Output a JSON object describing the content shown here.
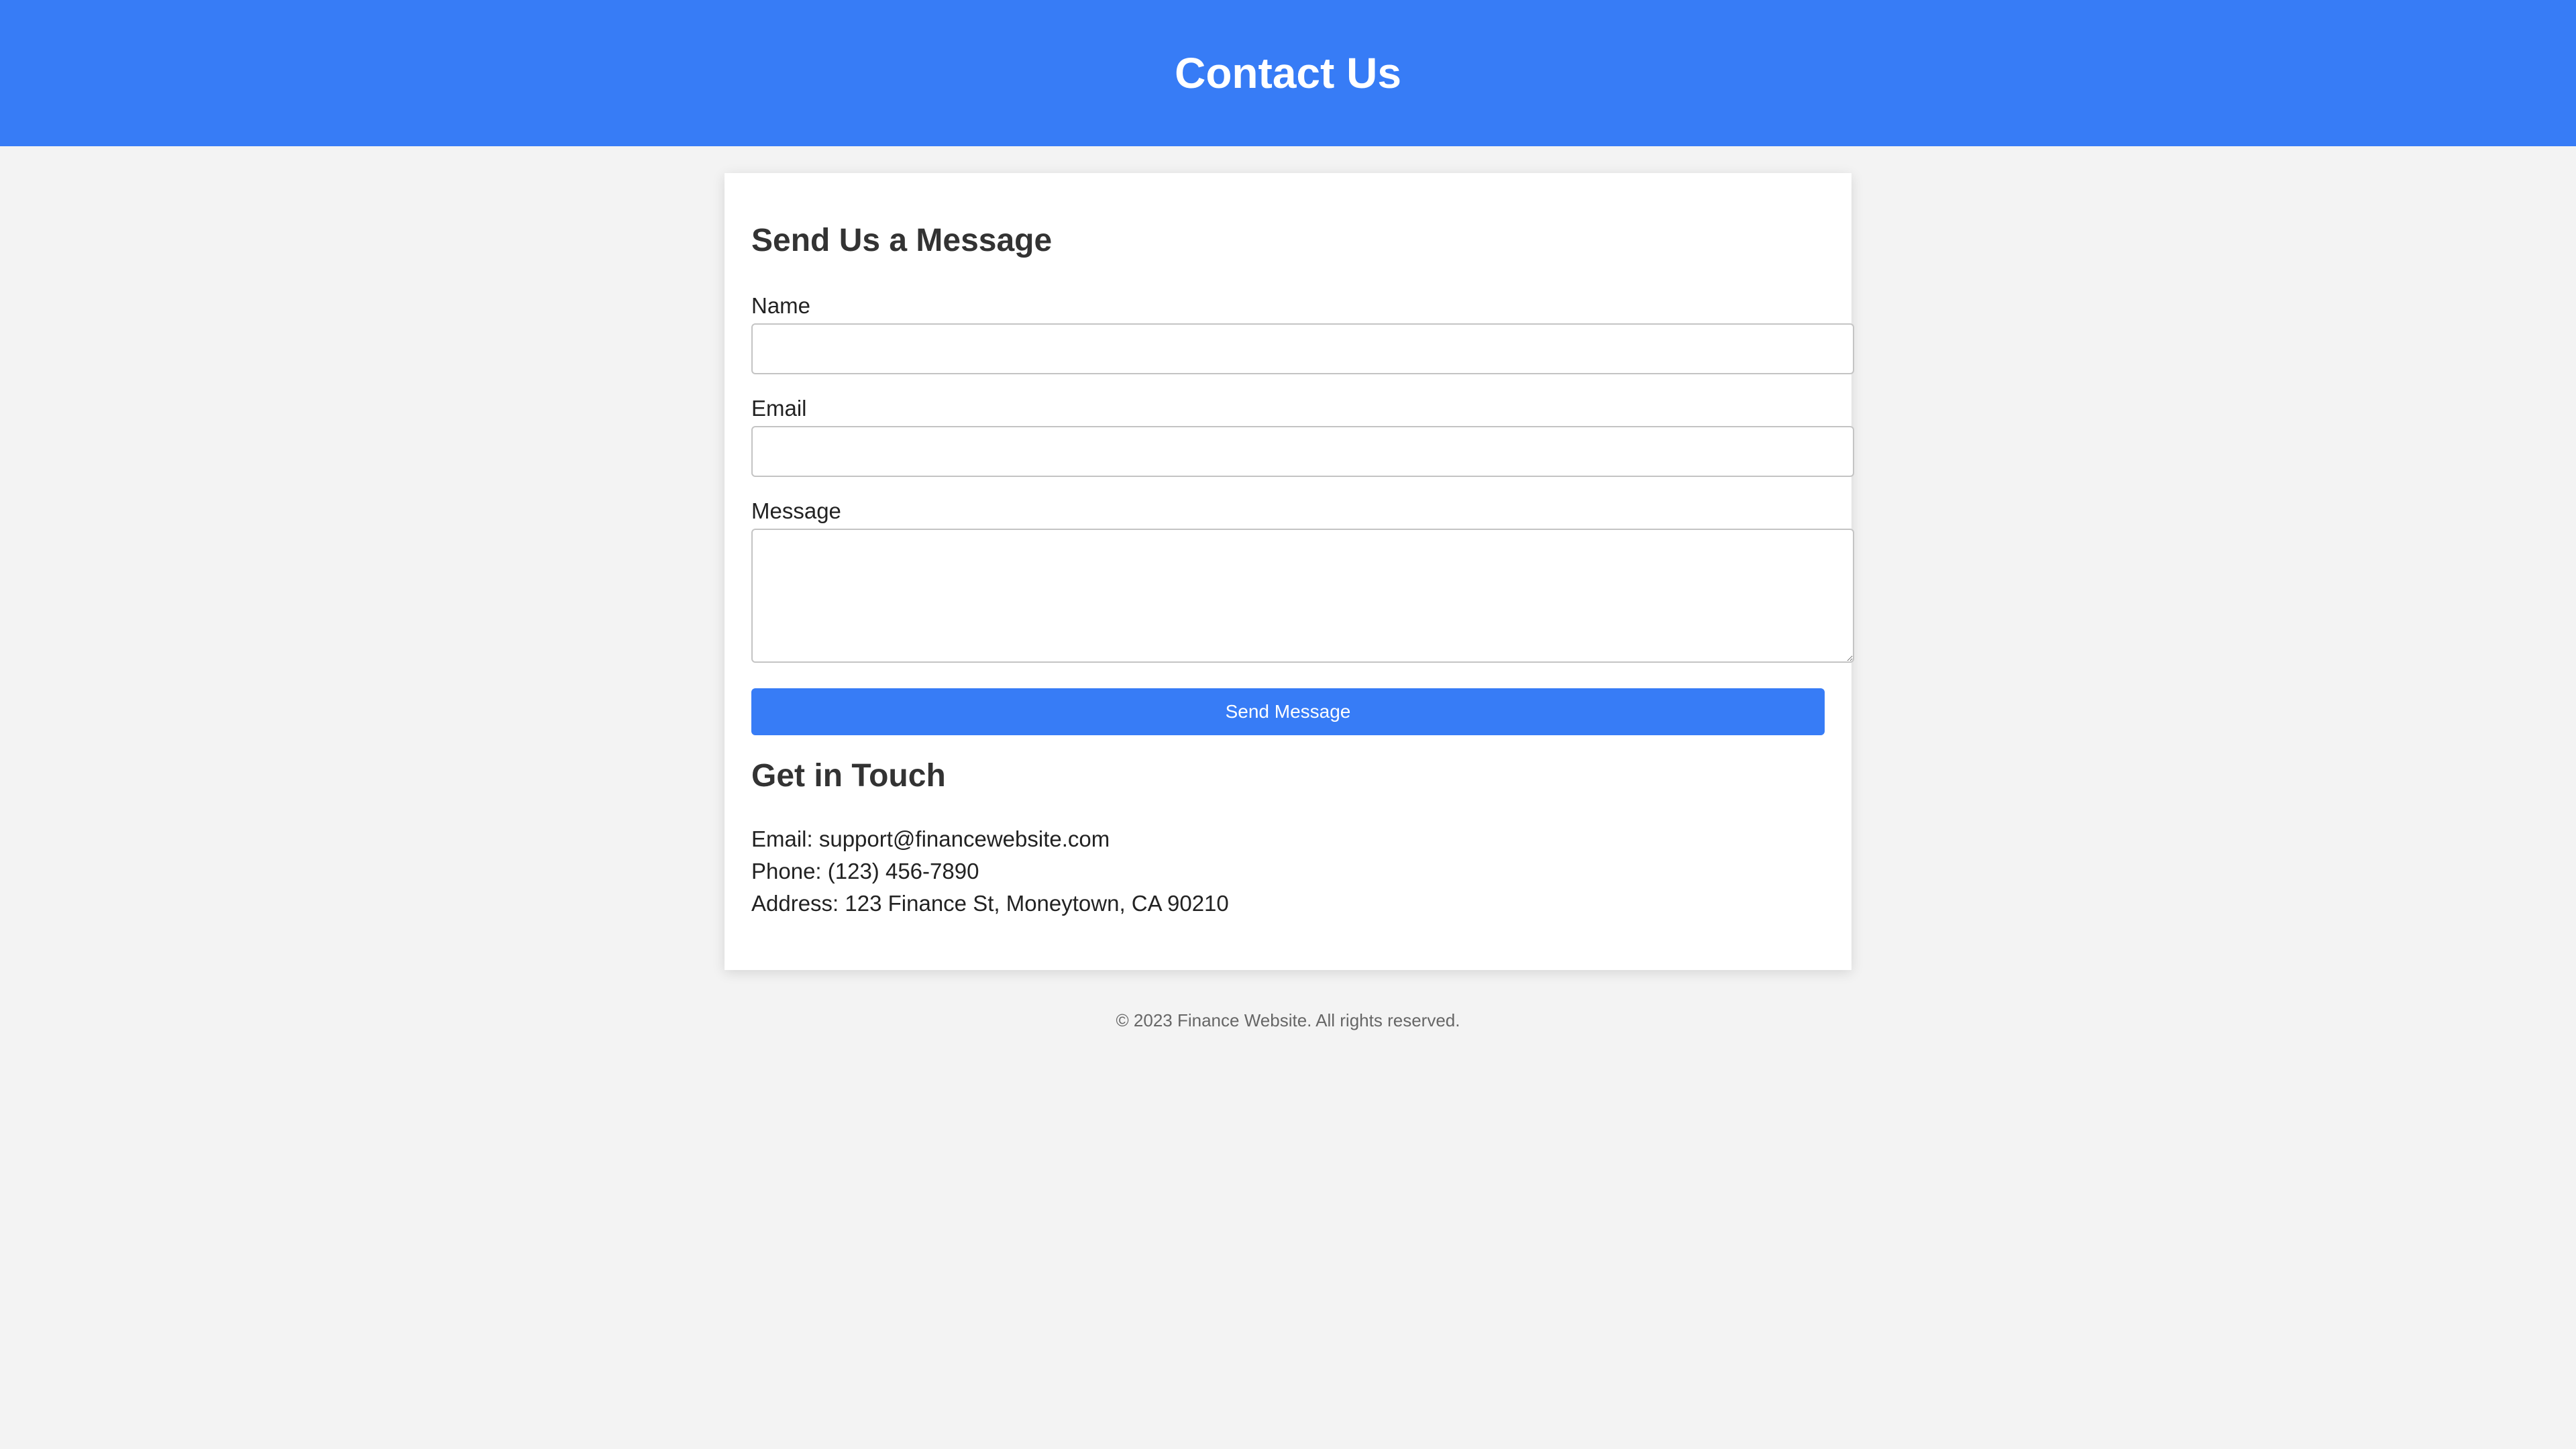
{
  "header": {
    "title": "Contact Us"
  },
  "form": {
    "title": "Send Us a Message",
    "name_label": "Name",
    "name_value": "",
    "email_label": "Email",
    "email_value": "",
    "message_label": "Message",
    "message_value": "",
    "submit_label": "Send Message"
  },
  "contact": {
    "title": "Get in Touch",
    "email": "Email: support@financewebsite.com",
    "phone": "Phone: (123) 456-7890",
    "address": "Address: 123 Finance St, Moneytown, CA 90210"
  },
  "footer": {
    "text": "© 2023 Finance Website. All rights reserved."
  },
  "colors": {
    "primary": "#377cf6",
    "background": "#f3f3f3",
    "card": "#ffffff"
  }
}
